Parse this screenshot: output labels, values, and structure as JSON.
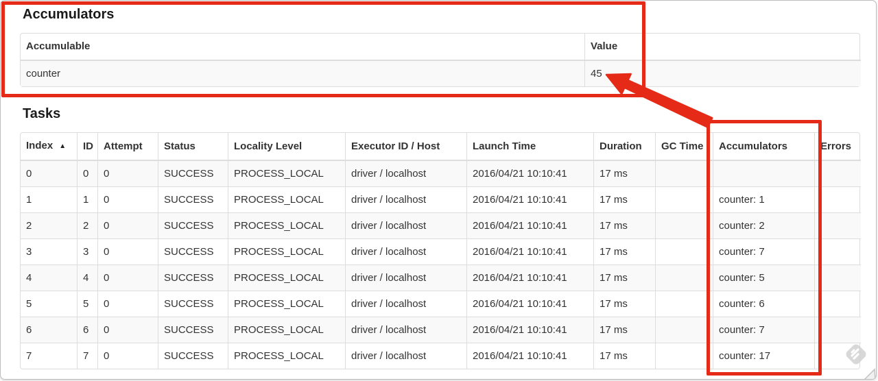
{
  "annotations": {
    "color": "#e52a18",
    "arrow_target": "45",
    "watermark": "skitch-diamond"
  },
  "accumulators_section": {
    "title": "Accumulators",
    "table": {
      "columns": {
        "accumulable": "Accumulable",
        "value": "Value"
      },
      "rows": [
        {
          "accumulable": "counter",
          "value": "45"
        }
      ]
    }
  },
  "tasks_section": {
    "title": "Tasks",
    "table": {
      "columns": {
        "index": "Index",
        "id": "ID",
        "attempt": "Attempt",
        "status": "Status",
        "locality": "Locality Level",
        "executor": "Executor ID / Host",
        "launch": "Launch Time",
        "duration": "Duration",
        "gc": "GC Time",
        "accumulators": "Accumulators",
        "errors": "Errors"
      },
      "sort_icon": "▲",
      "rows": [
        {
          "index": "0",
          "id": "0",
          "attempt": "0",
          "status": "SUCCESS",
          "locality": "PROCESS_LOCAL",
          "executor": "driver / localhost",
          "launch": "2016/04/21 10:10:41",
          "duration": "17 ms",
          "gc": "",
          "accumulators": "",
          "errors": ""
        },
        {
          "index": "1",
          "id": "1",
          "attempt": "0",
          "status": "SUCCESS",
          "locality": "PROCESS_LOCAL",
          "executor": "driver / localhost",
          "launch": "2016/04/21 10:10:41",
          "duration": "17 ms",
          "gc": "",
          "accumulators": "counter: 1",
          "errors": ""
        },
        {
          "index": "2",
          "id": "2",
          "attempt": "0",
          "status": "SUCCESS",
          "locality": "PROCESS_LOCAL",
          "executor": "driver / localhost",
          "launch": "2016/04/21 10:10:41",
          "duration": "17 ms",
          "gc": "",
          "accumulators": "counter: 2",
          "errors": ""
        },
        {
          "index": "3",
          "id": "3",
          "attempt": "0",
          "status": "SUCCESS",
          "locality": "PROCESS_LOCAL",
          "executor": "driver / localhost",
          "launch": "2016/04/21 10:10:41",
          "duration": "17 ms",
          "gc": "",
          "accumulators": "counter: 7",
          "errors": ""
        },
        {
          "index": "4",
          "id": "4",
          "attempt": "0",
          "status": "SUCCESS",
          "locality": "PROCESS_LOCAL",
          "executor": "driver / localhost",
          "launch": "2016/04/21 10:10:41",
          "duration": "17 ms",
          "gc": "",
          "accumulators": "counter: 5",
          "errors": ""
        },
        {
          "index": "5",
          "id": "5",
          "attempt": "0",
          "status": "SUCCESS",
          "locality": "PROCESS_LOCAL",
          "executor": "driver / localhost",
          "launch": "2016/04/21 10:10:41",
          "duration": "17 ms",
          "gc": "",
          "accumulators": "counter: 6",
          "errors": ""
        },
        {
          "index": "6",
          "id": "6",
          "attempt": "0",
          "status": "SUCCESS",
          "locality": "PROCESS_LOCAL",
          "executor": "driver / localhost",
          "launch": "2016/04/21 10:10:41",
          "duration": "17 ms",
          "gc": "",
          "accumulators": "counter: 7",
          "errors": ""
        },
        {
          "index": "7",
          "id": "7",
          "attempt": "0",
          "status": "SUCCESS",
          "locality": "PROCESS_LOCAL",
          "executor": "driver / localhost",
          "launch": "2016/04/21 10:10:41",
          "duration": "17 ms",
          "gc": "",
          "accumulators": "counter: 17",
          "errors": ""
        }
      ]
    }
  }
}
